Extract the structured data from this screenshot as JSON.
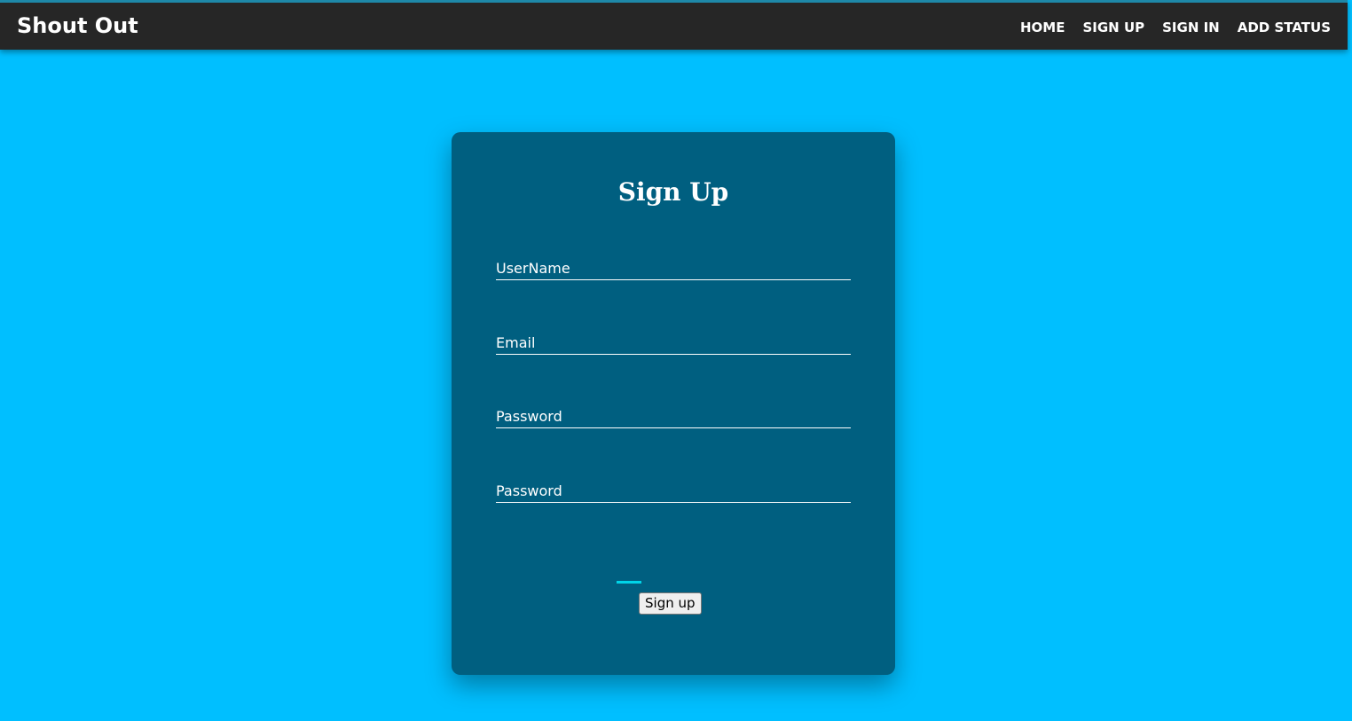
{
  "navbar": {
    "brand": "Shout Out",
    "links": [
      "HOME",
      "SIGN UP",
      "SIGN IN",
      "ADD STATUS"
    ]
  },
  "form": {
    "title": "Sign Up",
    "fields": [
      {
        "placeholder": "UserName",
        "value": ""
      },
      {
        "placeholder": "Email",
        "value": ""
      },
      {
        "placeholder": "Password",
        "value": ""
      },
      {
        "placeholder": "Password",
        "value": ""
      }
    ],
    "submit_label": "Sign up"
  },
  "colors": {
    "page_background": "#00bfff",
    "navbar_background": "#262626",
    "card_background": "#005f80",
    "accent": "#00d4e8"
  }
}
